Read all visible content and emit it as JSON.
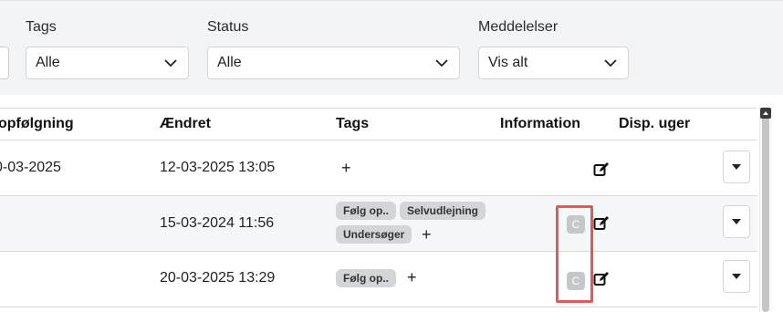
{
  "filters": {
    "tags": {
      "label": "Tags",
      "value": "Alle"
    },
    "status": {
      "label": "Status",
      "value": "Alle"
    },
    "messages": {
      "label": "Meddelelser",
      "value": "Vis alt"
    }
  },
  "table": {
    "headers": {
      "followup": "opfølgning",
      "changed": "Ændret",
      "tags": "Tags",
      "information": "Information",
      "disp_weeks": "Disp. uger"
    },
    "rows": [
      {
        "followup": "0-03-2025",
        "changed": "12-03-2025 13:05",
        "tags": [],
        "info_badge": "",
        "edit_icon": "edit-icon"
      },
      {
        "followup": "",
        "changed": "15-03-2024 11:56",
        "tags": [
          "Følg op..",
          "Selvudlejning",
          "Undersøger"
        ],
        "info_badge": "C",
        "edit_icon": "edit-icon"
      },
      {
        "followup": "",
        "changed": "20-03-2025 13:29",
        "tags": [
          "Følg op.."
        ],
        "info_badge": "C",
        "edit_icon": "edit-icon"
      }
    ],
    "add_tag_symbol": "+"
  },
  "colors": {
    "filter_bar_bg": "#f3f4f6",
    "tag_bg": "#d3d5d9",
    "badge_bg": "#c6c7c9",
    "highlight": "#e05a5a"
  }
}
